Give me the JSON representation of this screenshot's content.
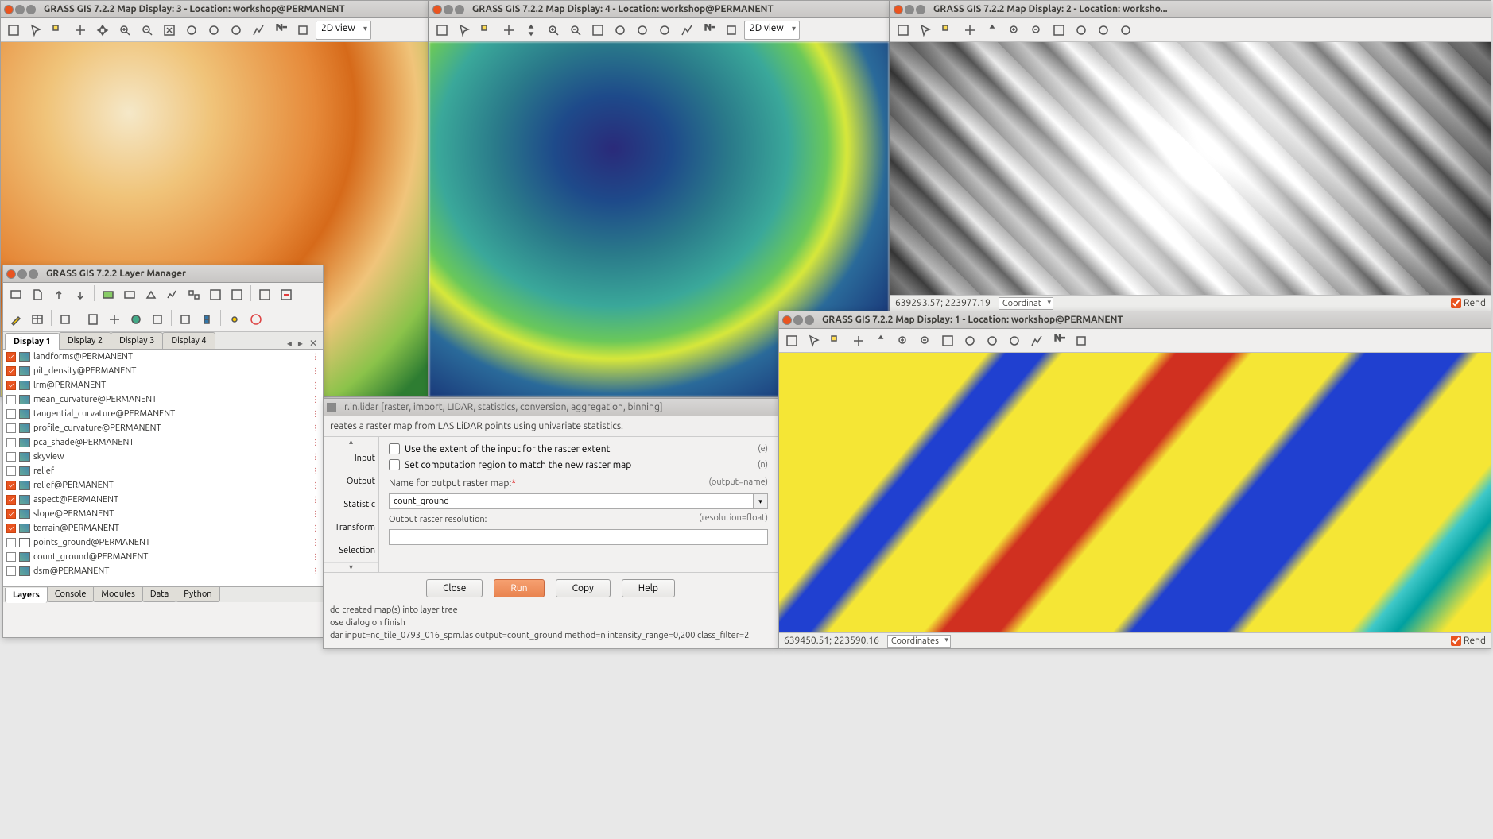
{
  "windows": {
    "map3": {
      "title": "GRASS GIS 7.2.2 Map Display: 3 - Location: workshop@PERMANENT",
      "view": "2D view"
    },
    "map4": {
      "title": "GRASS GIS 7.2.2 Map Display: 4 - Location: workshop@PERMANENT",
      "view": "2D view"
    },
    "map2": {
      "title": "GRASS GIS 7.2.2 Map Display: 2 - Location: worksho...",
      "coords": "639293.57; 223977.19",
      "dd": "Coordinat",
      "render": "Rend"
    },
    "map1": {
      "title": "GRASS GIS 7.2.2 Map Display: 1 - Location: workshop@PERMANENT",
      "coords": "639450.51; 223590.16",
      "dd": "Coordinates",
      "render": "Rend"
    },
    "layer_mgr": {
      "title": "GRASS GIS 7.2.2 Layer Manager"
    }
  },
  "display_tabs": [
    "Display 1",
    "Display 2",
    "Display 3",
    "Display 4"
  ],
  "active_display_tab": "Display 1",
  "layers": [
    {
      "checked": true,
      "name": "landforms@PERMANENT"
    },
    {
      "checked": true,
      "name": "pit_density@PERMANENT"
    },
    {
      "checked": true,
      "name": "lrm@PERMANENT"
    },
    {
      "checked": false,
      "name": "mean_curvature@PERMANENT"
    },
    {
      "checked": false,
      "name": "tangential_curvature@PERMANENT"
    },
    {
      "checked": false,
      "name": "profile_curvature@PERMANENT"
    },
    {
      "checked": false,
      "name": "pca_shade@PERMANENT"
    },
    {
      "checked": false,
      "name": "skyview"
    },
    {
      "checked": false,
      "name": "relief"
    },
    {
      "checked": true,
      "name": "relief@PERMANENT"
    },
    {
      "checked": true,
      "name": "aspect@PERMANENT"
    },
    {
      "checked": true,
      "name": "slope@PERMANENT"
    },
    {
      "checked": true,
      "name": "terrain@PERMANENT"
    },
    {
      "checked": false,
      "name": "points_ground@PERMANENT",
      "vector": true
    },
    {
      "checked": false,
      "name": "count_ground@PERMANENT"
    },
    {
      "checked": false,
      "name": "dsm@PERMANENT"
    }
  ],
  "bottom_tabs": [
    "Layers",
    "Console",
    "Modules",
    "Data",
    "Python"
  ],
  "active_bottom_tab": "Layers",
  "dialog": {
    "title": "r.in.lidar [raster, import, LIDAR, statistics, conversion, aggregation, binning]",
    "desc": "reates a raster map from LAS LiDAR points using univariate statistics.",
    "side_tabs": [
      "Input",
      "Output",
      "Statistic",
      "Transform",
      "Selection"
    ],
    "cb_extent": "Use the extent of the input for the raster extent",
    "cb_extent_hint": "(e)",
    "cb_region": "Set computation region to match the new raster map",
    "cb_region_hint": "(n)",
    "label_output": "Name for output raster map:",
    "output_hint": "(output=name)",
    "output_value": "count_ground",
    "label_res": "Output raster resolution:",
    "res_hint": "(resolution=float)",
    "res_value": "",
    "buttons": {
      "close": "Close",
      "run": "Run",
      "copy": "Copy",
      "help": "Help"
    },
    "footer1": "dd created map(s) into layer tree",
    "footer2": "ose dialog on finish",
    "footer3": "dar input=nc_tile_0793_016_spm.las output=count_ground method=n intensity_range=0,200 class_filter=2"
  }
}
